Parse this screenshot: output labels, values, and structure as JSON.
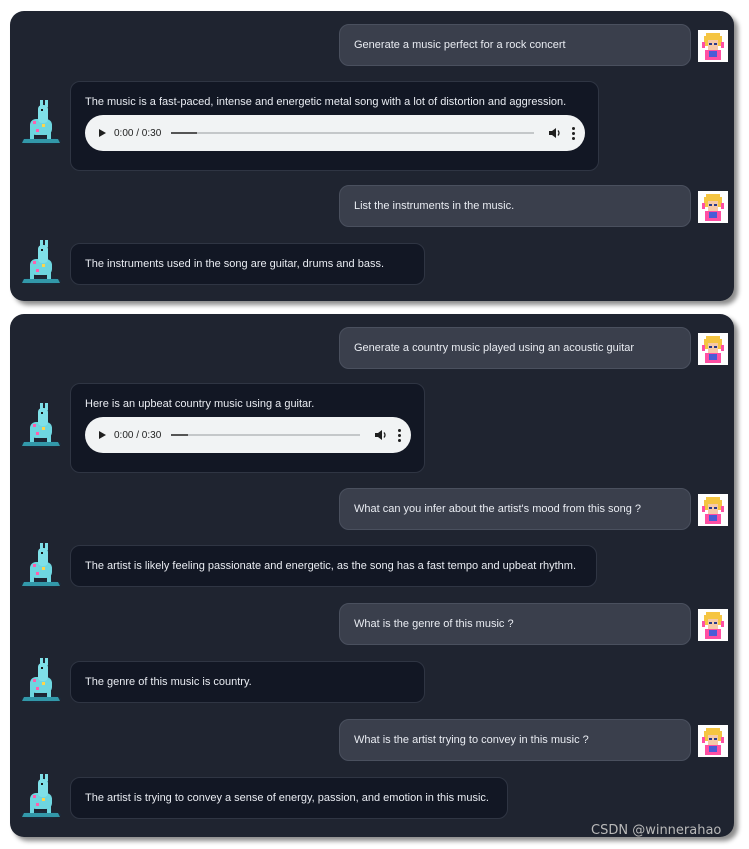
{
  "conversation_1": {
    "user_1": "Generate a music perfect for a rock concert",
    "bot_1": "The music is a fast-paced, intense and energetic metal song with a lot of distortion and aggression.",
    "bot_1_audio": {
      "time": "0:00 / 0:30",
      "progress": 0.07
    },
    "user_2": "List the instruments in the music.",
    "bot_2": "The instruments used in the song are guitar, drums and bass."
  },
  "conversation_2": {
    "user_1": "Generate a country music played using an acoustic guitar",
    "bot_1": "Here is an upbeat country music using a guitar.",
    "bot_1_audio": {
      "time": "0:00 / 0:30",
      "progress": 0.09
    },
    "user_2": "What can you infer about the artist's mood from this song ?",
    "bot_2": "The artist is likely feeling passionate and energetic, as the song has a fast tempo and upbeat rhythm.",
    "user_3": "What is the genre of this music ?",
    "bot_3": "The genre of this music is country.",
    "user_4": "What is the artist trying to convey in this music ?",
    "bot_4": "The artist is trying to convey a sense of energy, passion, and emotion in this music."
  },
  "watermark": "CSDN @winnerahao",
  "icons": {
    "user_avatar": "user-avatar-icon",
    "bot_avatar": "llama-avatar-icon"
  },
  "colors": {
    "panel": "#1f2430",
    "user_bubble": "#3a3f4c",
    "bot_bubble": "#121724"
  }
}
